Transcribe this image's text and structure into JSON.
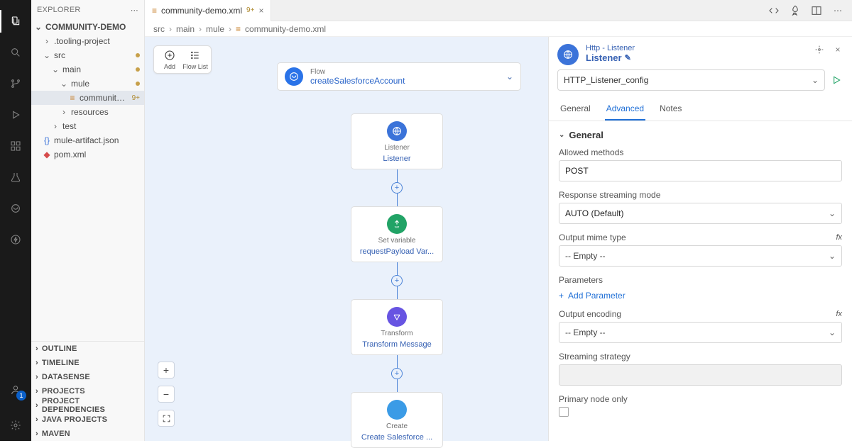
{
  "activity": {
    "accountBadge": "1"
  },
  "explorer": {
    "title": "Explorer",
    "workspace": "Community-Demo",
    "tree": [
      {
        "label": ".tooling-project",
        "depth": 1,
        "icon": "chev-r"
      },
      {
        "label": "src",
        "depth": 1,
        "icon": "chev-d",
        "dot": true
      },
      {
        "label": "main",
        "depth": 2,
        "icon": "chev-d",
        "dot": true
      },
      {
        "label": "mule",
        "depth": 3,
        "icon": "chev-d",
        "dot": true
      },
      {
        "label": "community-...",
        "depth": 4,
        "icon": "file",
        "sel": true,
        "badge": "9+"
      },
      {
        "label": "resources",
        "depth": 3,
        "icon": "chev-r"
      },
      {
        "label": "test",
        "depth": 2,
        "icon": "chev-r"
      },
      {
        "label": "mule-artifact.json",
        "depth": 1,
        "icon": "file-b"
      },
      {
        "label": "pom.xml",
        "depth": 1,
        "icon": "file-r"
      }
    ],
    "sections": [
      "Outline",
      "Timeline",
      "DataSense",
      "Projects",
      "Project Dependencies",
      "Java Projects",
      "Maven"
    ]
  },
  "tab": {
    "filename": "community-demo.xml",
    "modified": "9+"
  },
  "breadcrumb": [
    "src",
    "main",
    "mule",
    "community-demo.xml"
  ],
  "toolbox": {
    "add": "Add",
    "flowList": "Flow List"
  },
  "flowBar": {
    "sub": "Flow",
    "name": "createSalesforceAccount"
  },
  "nodes": [
    {
      "iconClass": "ic-blue",
      "sub": "Listener",
      "name": "Listener",
      "glyph": "globe"
    },
    {
      "iconClass": "ic-green",
      "sub": "Set variable",
      "name": "requestPayload Var...",
      "glyph": "var"
    },
    {
      "iconClass": "ic-purple",
      "sub": "Transform",
      "name": "Transform Message",
      "glyph": "transform"
    },
    {
      "iconClass": "ic-sf",
      "sub": "Create",
      "name": "Create Salesforce ...",
      "glyph": "cloud"
    }
  ],
  "props": {
    "header": {
      "sub": "Http - Listener",
      "title": "Listener"
    },
    "config": "HTTP_Listener_config",
    "tabs": [
      "General",
      "Advanced",
      "Notes"
    ],
    "activeTab": "Advanced",
    "section": "General",
    "fields": {
      "allowedMethodsLabel": "Allowed methods",
      "allowedMethods": "POST",
      "responseStreamingLabel": "Response streaming mode",
      "responseStreaming": "AUTO (Default)",
      "outputMimeLabel": "Output mime type",
      "outputMime": "-- Empty --",
      "parametersLabel": "Parameters",
      "addParameter": "Add Parameter",
      "outputEncodingLabel": "Output encoding",
      "outputEncoding": "-- Empty --",
      "streamingStrategyLabel": "Streaming strategy",
      "primaryNodeLabel": "Primary node only"
    }
  }
}
